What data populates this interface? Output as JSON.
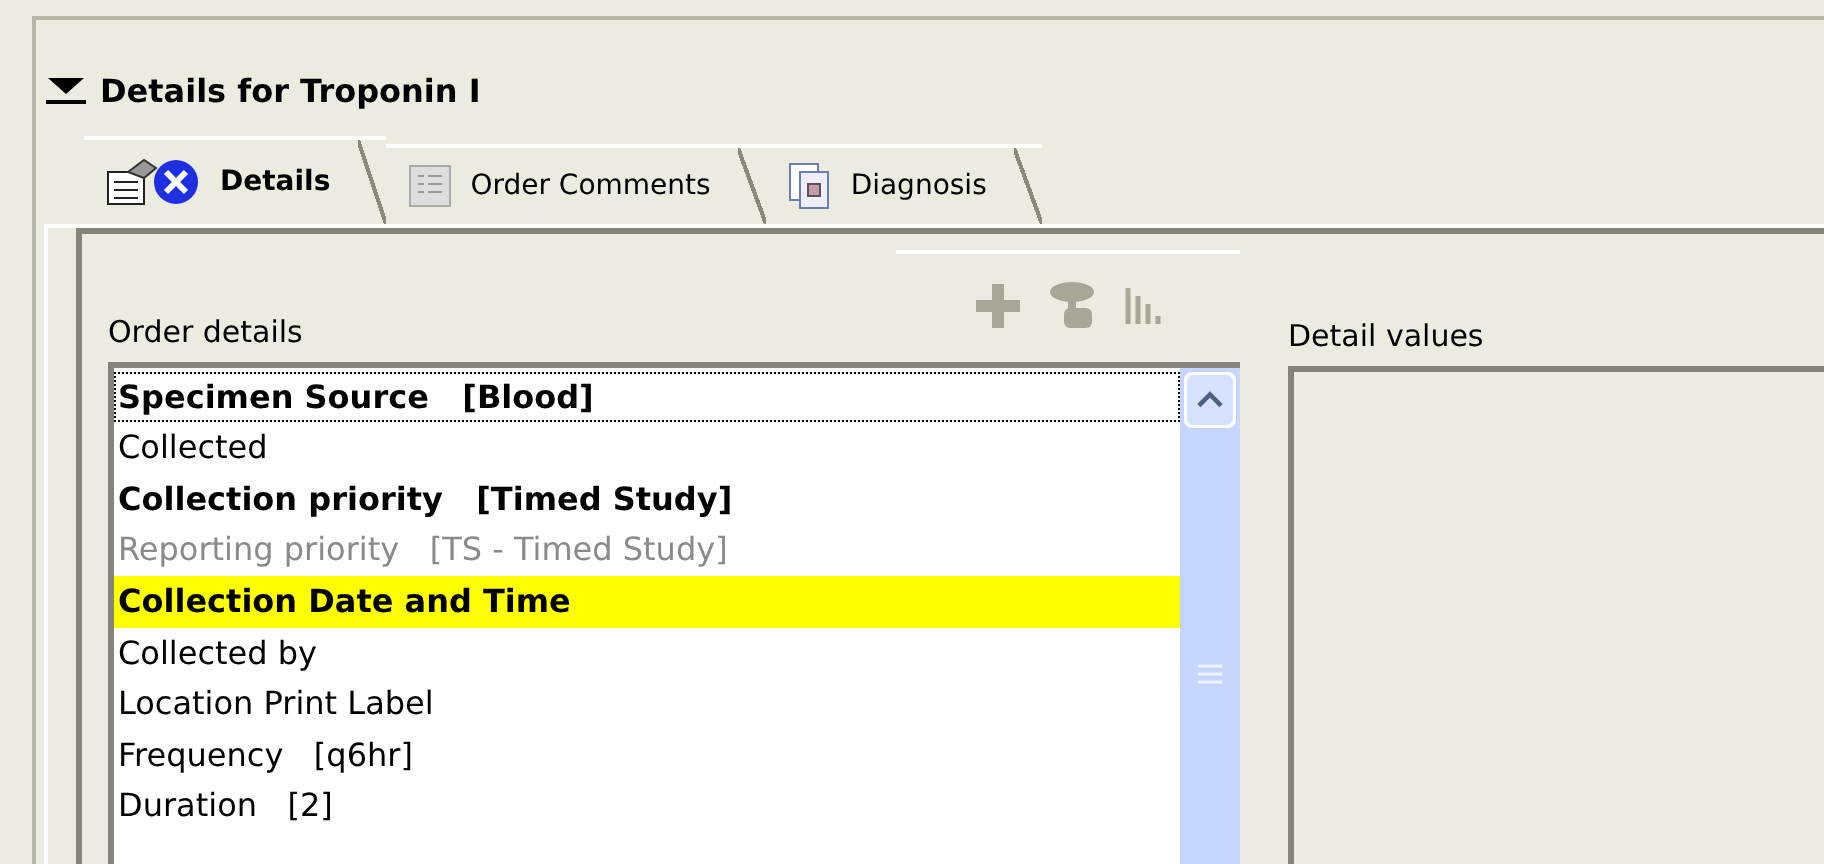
{
  "section": {
    "title": "Details for Troponin I",
    "expanded": true
  },
  "tabs": [
    {
      "label": "Details",
      "selected": true
    },
    {
      "label": "Order Comments",
      "selected": false
    },
    {
      "label": "Diagnosis",
      "selected": false
    }
  ],
  "order_details": {
    "label": "Order details",
    "toolbar": [
      {
        "disabled": true
      },
      {
        "disabled": true
      },
      {
        "disabled": true
      }
    ],
    "items": [
      {
        "text": "Specimen Source   [Blood]",
        "required": true,
        "disabled": false,
        "highlighted": false,
        "focused": true
      },
      {
        "text": "Collected",
        "required": false,
        "disabled": false,
        "highlighted": false,
        "focused": false
      },
      {
        "text": "Collection priority   [Timed Study]",
        "required": true,
        "disabled": false,
        "highlighted": false,
        "focused": false
      },
      {
        "text": "Reporting priority   [TS - Timed Study]",
        "required": false,
        "disabled": true,
        "highlighted": false,
        "focused": false
      },
      {
        "text": "Collection Date and Time",
        "required": true,
        "disabled": false,
        "highlighted": true,
        "focused": false
      },
      {
        "text": "Collected by",
        "required": false,
        "disabled": false,
        "highlighted": false,
        "focused": false
      },
      {
        "text": "Location Print Label",
        "required": false,
        "disabled": false,
        "highlighted": false,
        "focused": false
      },
      {
        "text": "Frequency   [q6hr]",
        "required": false,
        "disabled": false,
        "highlighted": false,
        "focused": false
      },
      {
        "text": "Duration   [2]",
        "required": false,
        "disabled": false,
        "highlighted": false,
        "focused": false
      }
    ]
  },
  "detail_values": {
    "label": "Detail values"
  }
}
